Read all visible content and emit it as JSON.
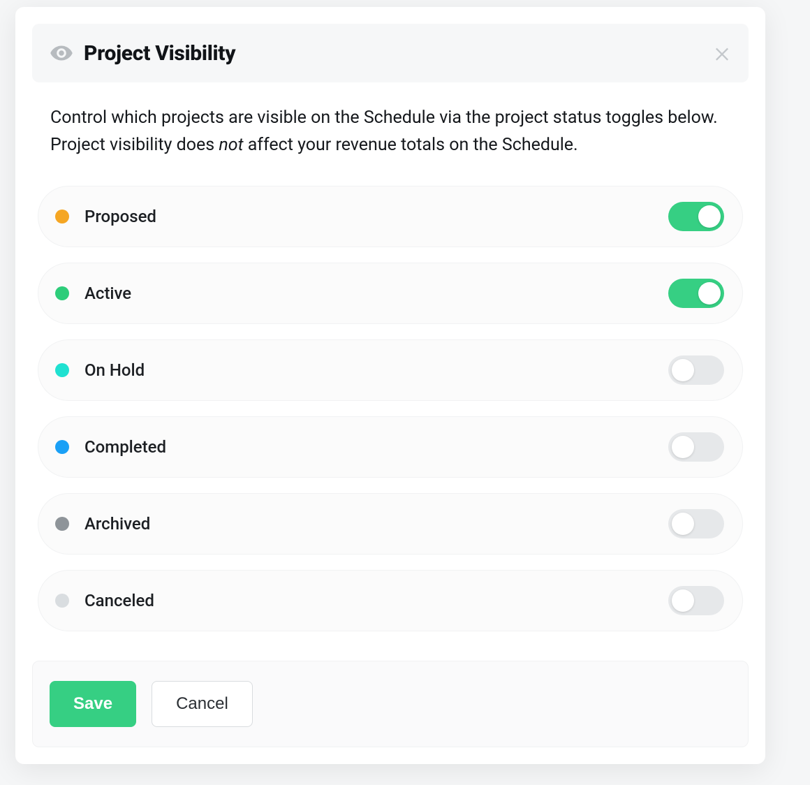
{
  "modal": {
    "title": "Project Visibility",
    "description_pre": "Control which projects are visible on the Schedule via the project status toggles below. Project visibility does ",
    "description_em": "not",
    "description_post": " affect your revenue totals on the Schedule.",
    "save_label": "Save",
    "cancel_label": "Cancel"
  },
  "colors": {
    "proposed": "#f5a623",
    "active": "#2dcd7a",
    "onhold": "#1fe1d1",
    "completed": "#1aa0f6",
    "archived": "#8e9499",
    "canceled": "#d9dde0",
    "toggle_on": "#36cf83",
    "toggle_off": "#e6e8ea"
  },
  "options": [
    {
      "key": "proposed",
      "label": "Proposed",
      "dotColorKey": "proposed",
      "on": true
    },
    {
      "key": "active",
      "label": "Active",
      "dotColorKey": "active",
      "on": true
    },
    {
      "key": "onhold",
      "label": "On Hold",
      "dotColorKey": "onhold",
      "on": false
    },
    {
      "key": "completed",
      "label": "Completed",
      "dotColorKey": "completed",
      "on": false
    },
    {
      "key": "archived",
      "label": "Archived",
      "dotColorKey": "archived",
      "on": false
    },
    {
      "key": "canceled",
      "label": "Canceled",
      "dotColorKey": "canceled",
      "on": false
    }
  ]
}
